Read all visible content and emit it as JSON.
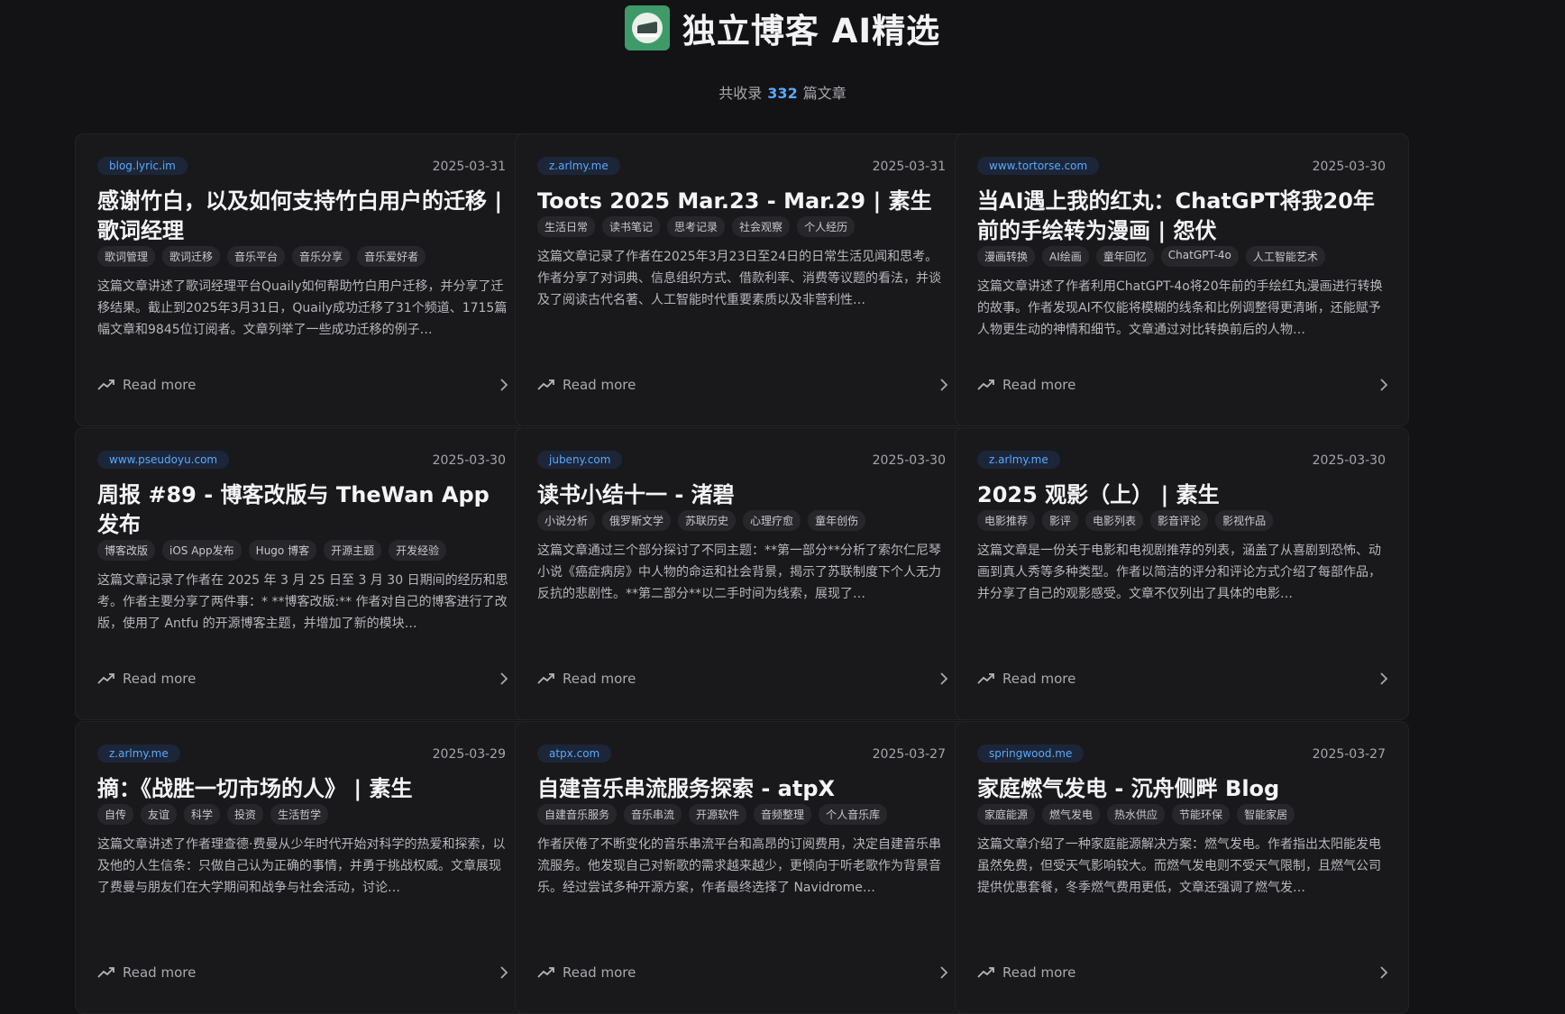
{
  "header": {
    "title": "独立博客 AI精选",
    "count_prefix": "共收录",
    "count": "332",
    "count_suffix": "篇文章",
    "logo_icon": "book-stack-logo"
  },
  "read_more_label": "Read more",
  "colors": {
    "background": "#131315",
    "card": "#19191c",
    "accent": "#5aa8ff"
  },
  "cards": [
    {
      "domain": "blog.lyric.im",
      "date": "2025-03-31",
      "title": "感谢竹白，以及如何支持竹白用户的迁移 | 歌词经理",
      "tags": [
        "歌词管理",
        "歌词迁移",
        "音乐平台",
        "音乐分享",
        "音乐爱好者"
      ],
      "summary": "这篇文章讲述了歌词经理平台Quaily如何帮助竹白用户迁移，并分享了迁移结果。截止到2025年3月31日，Quaily成功迁移了31个频道、1715篇幅文章和9845位订阅者。文章列举了一些成功迁移的例子…"
    },
    {
      "domain": "z.arlmy.me",
      "date": "2025-03-31",
      "title": "Toots 2025 Mar.23 - Mar.29 | 素生",
      "tags": [
        "生活日常",
        "读书笔记",
        "思考记录",
        "社会观察",
        "个人经历"
      ],
      "summary": "这篇文章记录了作者在2025年3月23日至24日的日常生活见闻和思考。作者分享了对词典、信息组织方式、借款利率、消费等议题的看法，并谈及了阅读古代名著、人工智能时代重要素质以及非营利性…"
    },
    {
      "domain": "www.tortorse.com",
      "date": "2025-03-30",
      "title": "当AI遇上我的红丸：ChatGPT将我20年前的手绘转为漫画 | 怨伏",
      "tags": [
        "漫画转换",
        "AI绘画",
        "童年回忆",
        "ChatGPT-4o",
        "人工智能艺术"
      ],
      "summary": "这篇文章讲述了作者利用ChatGPT-4o将20年前的手绘红丸漫画进行转换的故事。作者发现AI不仅能将模糊的线条和比例调整得更清晰，还能赋予人物更生动的神情和细节。文章通过对比转换前后的人物…"
    },
    {
      "domain": "www.pseudoyu.com",
      "date": "2025-03-30",
      "title": "周报 #89 - 博客改版与 TheWan App 发布",
      "tags": [
        "博客改版",
        "iOS App发布",
        "Hugo 博客",
        "开源主题",
        "开发经验"
      ],
      "summary": "这篇文章记录了作者在 2025 年 3 月 25 日至 3 月 30 日期间的经历和思考。作者主要分享了两件事：* **博客改版:** 作者对自己的博客进行了改版，使用了 Antfu 的开源博客主题，并增加了新的模块…"
    },
    {
      "domain": "jubeny.com",
      "date": "2025-03-30",
      "title": "读书小结十一 - 渚碧",
      "tags": [
        "小说分析",
        "俄罗斯文学",
        "苏联历史",
        "心理疗愈",
        "童年创伤"
      ],
      "summary": "这篇文章通过三个部分探讨了不同主题：**第一部分**分析了索尔仁尼琴小说《癌症病房》中人物的命运和社会背景，揭示了苏联制度下个人无力反抗的悲剧性。**第二部分**以二手时间为线索，展现了…"
    },
    {
      "domain": "z.arlmy.me",
      "date": "2025-03-30",
      "title": "2025 观影（上） | 素生",
      "tags": [
        "电影推荐",
        "影评",
        "电影列表",
        "影音评论",
        "影视作品"
      ],
      "summary": "这篇文章是一份关于电影和电视剧推荐的列表，涵盖了从喜剧到恐怖、动画到真人秀等多种类型。作者以简洁的评分和评论方式介绍了每部作品，并分享了自己的观影感受。文章不仅列出了具体的电影…"
    },
    {
      "domain": "z.arlmy.me",
      "date": "2025-03-29",
      "title": "摘：《战胜一切市场的人》 | 素生",
      "tags": [
        "自传",
        "友谊",
        "科学",
        "投资",
        "生活哲学"
      ],
      "summary": "这篇文章讲述了作者理查德·费曼从少年时代开始对科学的热爱和探索，以及他的人生信条：只做自己认为正确的事情，并勇于挑战权威。文章展现了费曼与朋友们在大学期间和战争与社会活动，讨论…"
    },
    {
      "domain": "atpx.com",
      "date": "2025-03-27",
      "title": "自建音乐串流服务探索 - atpX",
      "tags": [
        "自建音乐服务",
        "音乐串流",
        "开源软件",
        "音频整理",
        "个人音乐库"
      ],
      "summary": "作者厌倦了不断变化的音乐串流平台和高昂的订阅费用，决定自建音乐串流服务。他发现自己对新歌的需求越来越少，更倾向于听老歌作为背景音乐。经过尝试多种开源方案，作者最终选择了 Navidrome…"
    },
    {
      "domain": "springwood.me",
      "date": "2025-03-27",
      "title": "家庭燃气发电 - 沉舟侧畔 Blog",
      "tags": [
        "家庭能源",
        "燃气发电",
        "热水供应",
        "节能环保",
        "智能家居"
      ],
      "summary": "这篇文章介绍了一种家庭能源解决方案：燃气发电。作者指出太阳能发电虽然免费，但受天气影响较大。而燃气发电则不受天气限制，且燃气公司提供优惠套餐，冬季燃气费用更低，文章还强调了燃气发…"
    }
  ]
}
